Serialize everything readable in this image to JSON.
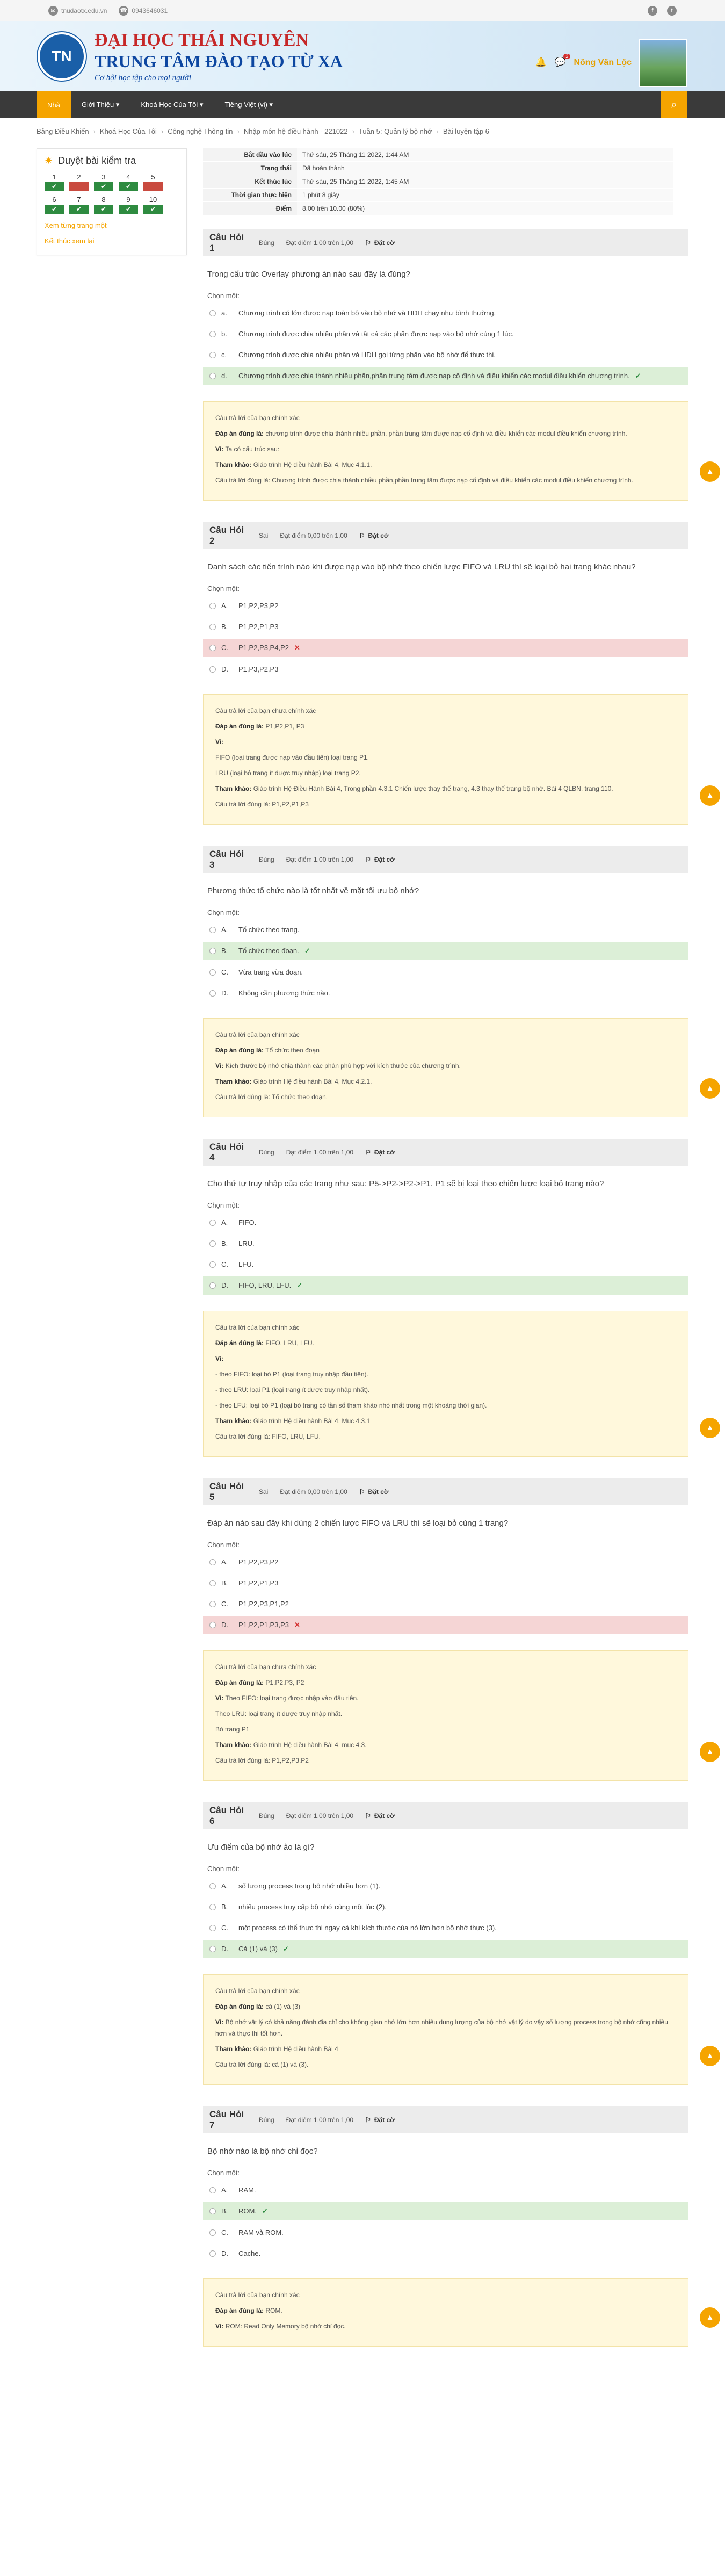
{
  "topbar": {
    "email": "tnudaotx.edu.vn",
    "phone": "0943646031"
  },
  "header": {
    "logo_text": "TN",
    "line1": "ĐẠI HỌC THÁI NGUYÊN",
    "line2": "TRUNG TÂM ĐÀO TẠO TỪ XA",
    "line3": "Cơ hội học tập cho mọi người",
    "user": "Nông Văn Lộc",
    "chat_badge": "2"
  },
  "nav": {
    "items": [
      "Nhà",
      "Giới Thiệu ▾",
      "Khoá Học Của Tôi ▾",
      "Tiếng Việt (vi) ▾"
    ]
  },
  "breadcrumb": [
    "Bảng Điều Khiển",
    "Khoá Học Của Tôi",
    "Công nghệ Thông tin",
    "Nhập môn hệ điều hành - 221022",
    "Tuần 5: Quản lý bộ nhớ",
    "Bài luyện tập 6"
  ],
  "sidebar": {
    "title": "Duyệt bài kiểm tra",
    "cells": [
      {
        "n": "1",
        "s": "ok"
      },
      {
        "n": "2",
        "s": "bad"
      },
      {
        "n": "3",
        "s": "ok"
      },
      {
        "n": "4",
        "s": "ok"
      },
      {
        "n": "5",
        "s": "bad"
      },
      {
        "n": "6",
        "s": "ok"
      },
      {
        "n": "7",
        "s": "ok"
      },
      {
        "n": "8",
        "s": "ok"
      },
      {
        "n": "9",
        "s": "ok"
      },
      {
        "n": "10",
        "s": "ok"
      }
    ],
    "link1": "Xem từng trang một",
    "link2": "Kết thúc xem lại"
  },
  "summary": [
    {
      "k": "Bắt đầu vào lúc",
      "v": "Thứ sáu, 25 Tháng 11 2022, 1:44 AM"
    },
    {
      "k": "Trạng thái",
      "v": "Đã hoàn thành"
    },
    {
      "k": "Kết thúc lúc",
      "v": "Thứ sáu, 25 Tháng 11 2022, 1:45 AM"
    },
    {
      "k": "Thời gian thực hiện",
      "v": "1 phút 8 giây"
    },
    {
      "k": "Điểm",
      "v": "8.00 trên 10.00 (80%)"
    }
  ],
  "labels": {
    "choose": "Chọn một:",
    "flag": "Đặt cờ"
  },
  "questions": [
    {
      "title": "Câu Hỏi 1",
      "status": "Đúng",
      "score": "Đạt điểm 1,00 trên 1,00",
      "text": "Trong cấu trúc Overlay phương án nào sau đây là đúng?",
      "options": [
        {
          "l": "a.",
          "t": "Chương trình có lớn được nạp toàn bộ vào bộ nhớ và HĐH chạy như bình thường.",
          "s": ""
        },
        {
          "l": "b.",
          "t": "Chương trình được chia nhiều phần và tất cả các phần được nạp vào bộ nhớ cùng 1 lúc.",
          "s": ""
        },
        {
          "l": "c.",
          "t": "Chương trình được chia nhiều phần và HĐH gọi từng phần vào bộ nhớ để thực thi.",
          "s": ""
        },
        {
          "l": "d.",
          "t": "Chương trình được chia thành nhiều phần,phần trung tâm được nạp cố định và điều khiển các modul điều khiển chương trình.",
          "s": "correct"
        }
      ],
      "fb": [
        {
          "b": "",
          "t": "Câu trả lời của bạn chính xác"
        },
        {
          "b": "Đáp án đúng là:",
          "t": "chương trình được chia thành nhiều phần, phần trung tâm được nạp cố định và điều khiển các modul điều khiển chương trình."
        },
        {
          "b": "Vì:",
          "t": "Ta có cấu trúc sau:"
        },
        {
          "b": "Tham khảo:",
          "t": "Giáo trình Hệ điều hành Bài 4, Mục 4.1.1."
        },
        {
          "b": "",
          "t": "Câu trả lời đúng là: Chương trình được chia thành nhiều phần,phần trung tâm được nạp cố định và điều khiển các modul điều khiển chương trình."
        }
      ]
    },
    {
      "title": "Câu Hỏi 2",
      "status": "Sai",
      "score": "Đạt điểm 0,00 trên 1,00",
      "text": "Danh sách các tiến trình nào khi được nạp vào bộ nhớ theo chiến lược FIFO và LRU thì sẽ loại bỏ hai trang khác nhau?",
      "options": [
        {
          "l": "A.",
          "t": "P1,P2,P3,P2",
          "s": ""
        },
        {
          "l": "B.",
          "t": "P1,P2,P1,P3",
          "s": ""
        },
        {
          "l": "C.",
          "t": "P1,P2,P3,P4,P2",
          "s": "wrong"
        },
        {
          "l": "D.",
          "t": "P1,P3,P2,P3",
          "s": ""
        }
      ],
      "fb": [
        {
          "b": "",
          "t": "Câu trả lời của bạn chưa chính xác"
        },
        {
          "b": "Đáp án đúng là:",
          "t": "P1,P2,P1, P3"
        },
        {
          "b": "Vì:",
          "t": ""
        },
        {
          "b": "",
          "t": "FIFO (loại trang được nạp vào đầu tiên) loại trang P1."
        },
        {
          "b": "",
          "t": "LRU (loại bỏ trang ít được truy nhập) loại trang P2."
        },
        {
          "b": "Tham khảo:",
          "t": "Giáo trình Hệ Điều Hành Bài 4, Trong phần 4.3.1 Chiến lược thay thế trang, 4.3 thay thế trang bộ nhớ. Bài 4 QLBN, trang 110."
        },
        {
          "b": "",
          "t": "Câu trả lời đúng là: P1,P2,P1,P3"
        }
      ]
    },
    {
      "title": "Câu Hỏi 3",
      "status": "Đúng",
      "score": "Đạt điểm 1,00 trên 1,00",
      "text": "Phương thức tổ chức nào là tốt nhất về mặt tối ưu bộ nhớ?",
      "options": [
        {
          "l": "A.",
          "t": "Tổ chức theo trang.",
          "s": ""
        },
        {
          "l": "B.",
          "t": "Tổ chức theo đoạn.",
          "s": "correct"
        },
        {
          "l": "C.",
          "t": "Vừa trang vừa đoạn.",
          "s": ""
        },
        {
          "l": "D.",
          "t": "Không cần phương thức nào.",
          "s": ""
        }
      ],
      "fb": [
        {
          "b": "",
          "t": "Câu trả lời của bạn chính xác"
        },
        {
          "b": "Đáp án đúng là:",
          "t": "Tổ chức theo đoạn"
        },
        {
          "b": "Vì:",
          "t": "Kích thước bộ nhớ chia thành các phân phù hợp với kích thước của chương trình."
        },
        {
          "b": "Tham khảo:",
          "t": "Giáo trình Hệ điều hành Bài 4, Mục 4.2.1."
        },
        {
          "b": "",
          "t": "Câu trả lời đúng là: Tổ chức theo đoạn."
        }
      ]
    },
    {
      "title": "Câu Hỏi 4",
      "status": "Đúng",
      "score": "Đạt điểm 1,00 trên 1,00",
      "text": "Cho thứ tự truy nhập của các trang như sau: P5->P2->P2->P1. P1 sẽ bị loại theo chiến lược loại bỏ trang nào?",
      "options": [
        {
          "l": "A.",
          "t": "FIFO.",
          "s": ""
        },
        {
          "l": "B.",
          "t": "LRU.",
          "s": ""
        },
        {
          "l": "C.",
          "t": "LFU.",
          "s": ""
        },
        {
          "l": "D.",
          "t": "FIFO, LRU, LFU.",
          "s": "correct"
        }
      ],
      "fb": [
        {
          "b": "",
          "t": "Câu trả lời của bạn chính xác"
        },
        {
          "b": "Đáp án đúng là:",
          "t": "FIFO, LRU, LFU."
        },
        {
          "b": "Vì:",
          "t": ""
        },
        {
          "b": "",
          "t": "- theo FIFO: loại bỏ P1 (loại trang truy nhập đầu tiên)."
        },
        {
          "b": "",
          "t": "- theo LRU: loại P1 (loại trang ít được truy nhập nhất)."
        },
        {
          "b": "",
          "t": "- theo LFU: loại bỏ P1 (loại bỏ trang có tần số tham khảo nhỏ nhất trong một khoảng thời gian)."
        },
        {
          "b": "Tham khảo:",
          "t": "Giáo trình Hệ điều hành Bài 4, Mục 4.3.1"
        },
        {
          "b": "",
          "t": "Câu trả lời đúng là: FIFO, LRU, LFU."
        }
      ]
    },
    {
      "title": "Câu Hỏi 5",
      "status": "Sai",
      "score": "Đạt điểm 0,00 trên 1,00",
      "text": "Đáp án nào sau đây khi dùng 2 chiến lược FIFO và LRU thì sẽ loại bỏ cùng 1 trang?",
      "options": [
        {
          "l": "A.",
          "t": "P1,P2,P3,P2",
          "s": ""
        },
        {
          "l": "B.",
          "t": "P1,P2,P1,P3",
          "s": ""
        },
        {
          "l": "C.",
          "t": "P1,P2,P3,P1,P2",
          "s": ""
        },
        {
          "l": "D.",
          "t": "P1,P2,P1,P3,P3",
          "s": "wrong"
        }
      ],
      "fb": [
        {
          "b": "",
          "t": "Câu trả lời của bạn chưa chính xác"
        },
        {
          "b": "Đáp án đúng là:",
          "t": "P1,P2,P3, P2"
        },
        {
          "b": "Vì:",
          "t": "Theo FIFO: loại trang được nhập vào đầu tiên."
        },
        {
          "b": "",
          "t": "Theo LRU: loại trang ít được truy nhập nhất."
        },
        {
          "b": "",
          "t": "Bỏ trang P1"
        },
        {
          "b": "Tham khảo:",
          "t": "Giáo trình Hệ điều hành Bài 4, mục 4.3."
        },
        {
          "b": "",
          "t": "Câu trả lời đúng là: P1,P2,P3,P2"
        }
      ]
    },
    {
      "title": "Câu Hỏi 6",
      "status": "Đúng",
      "score": "Đạt điểm 1,00 trên 1,00",
      "text": "Ưu điểm của bộ nhớ ảo là gì?",
      "options": [
        {
          "l": "A.",
          "t": "số lượng process trong bộ nhớ nhiều hơn (1).",
          "s": ""
        },
        {
          "l": "B.",
          "t": "nhiều process truy cập bộ nhớ cùng một lúc (2).",
          "s": ""
        },
        {
          "l": "C.",
          "t": "một process có thể thực thi ngay cả khi kích thước của nó lớn hơn bộ nhớ thực (3).",
          "s": ""
        },
        {
          "l": "D.",
          "t": "Cả (1) và (3)",
          "s": "correct"
        }
      ],
      "fb": [
        {
          "b": "",
          "t": "Câu trả lời của bạn chính xác"
        },
        {
          "b": "Đáp án đúng là:",
          "t": "cả (1) và (3)"
        },
        {
          "b": "Vì:",
          "t": "Bộ nhớ vật lý có khả năng đánh địa chỉ cho không gian nhớ lớn hơn nhiều dung lượng của bộ nhớ vật lý do vậy số lượng process trong bộ nhớ cũng nhiều hơn và thực thi tốt hơn."
        },
        {
          "b": "Tham khảo:",
          "t": "Giáo trình Hệ điều hành Bài 4"
        },
        {
          "b": "",
          "t": "Câu trả lời đúng là: cả (1) và (3)."
        }
      ]
    },
    {
      "title": "Câu Hỏi 7",
      "status": "Đúng",
      "score": "Đạt điểm 1,00 trên 1,00",
      "text": "Bộ nhớ nào là bộ nhớ chỉ đọc?",
      "options": [
        {
          "l": "A.",
          "t": "RAM.",
          "s": ""
        },
        {
          "l": "B.",
          "t": "ROM.",
          "s": "correct"
        },
        {
          "l": "C.",
          "t": "RAM và ROM.",
          "s": ""
        },
        {
          "l": "D.",
          "t": "Cache.",
          "s": ""
        }
      ],
      "fb": [
        {
          "b": "",
          "t": "Câu trả lời của bạn chính xác"
        },
        {
          "b": "Đáp án đúng là:",
          "t": "ROM."
        },
        {
          "b": "Vì:",
          "t": "ROM: Read Only Memory bộ nhớ chỉ đọc."
        }
      ]
    }
  ]
}
